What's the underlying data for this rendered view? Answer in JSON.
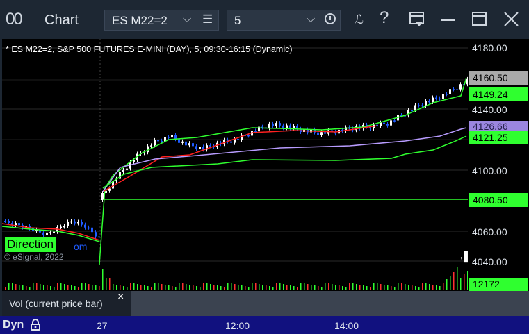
{
  "window": {
    "app_icon": "00",
    "title": "Chart",
    "symbol_value": "ES M22=2",
    "interval_value": "5",
    "buttons": {
      "draw": "draw-icon",
      "help": "?",
      "template": "template-icon",
      "minimize": "minimize-icon",
      "maximize": "maximize-icon",
      "close": "close-icon"
    }
  },
  "chart": {
    "description": "* ES M22=2, S&P 500 FUTURES E-MINI (DAY), 5, 09:30-16:15 (Dynamic)",
    "direction_label": "Direction",
    "direction_suffix": "om",
    "copyright": "© eSignal, 2022",
    "nav_arrow": "→▌",
    "colors": {
      "background": "#000000",
      "up_candle": "#ffffff",
      "down_candle": "#1f5bff",
      "vwap": "#ff2020",
      "band_green": "#2fff2f",
      "band_purple": "#b89cff"
    }
  },
  "price_axis": {
    "ticks": [
      "4180.00",
      "4140.00",
      "4100.00",
      "4060.00",
      "4040.00"
    ],
    "badges": {
      "last": "4160.50",
      "upper": "4149.24",
      "purple": "4126.66",
      "lower": "4121.25",
      "level": "4080.50"
    }
  },
  "volume": {
    "current": "12172",
    "legend": "Vol (current price bar)",
    "close_label": "×"
  },
  "time_axis": {
    "mode": "Dyn",
    "labels": [
      "27",
      "12:00",
      "14:00"
    ]
  }
}
